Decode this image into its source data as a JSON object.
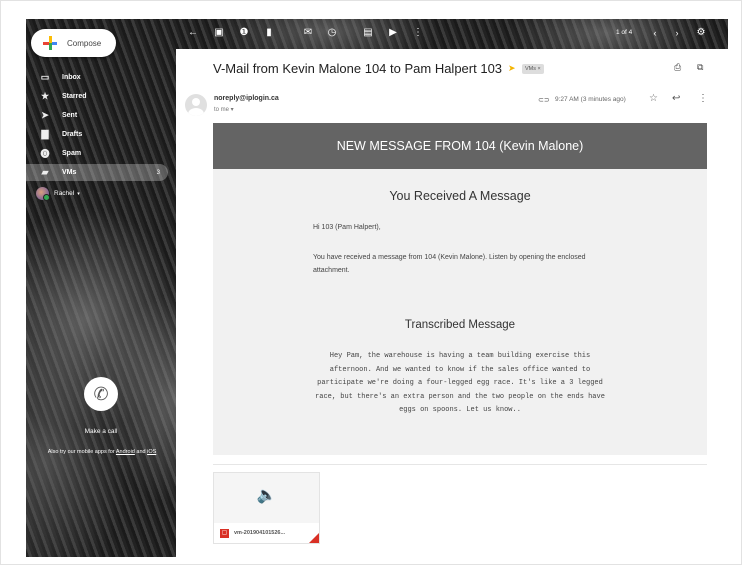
{
  "sidebar": {
    "compose_label": "Compose",
    "items": [
      {
        "label": "Inbox",
        "icon": "inbox-icon",
        "glyph": "▭"
      },
      {
        "label": "Starred",
        "icon": "star-icon",
        "glyph": "★"
      },
      {
        "label": "Sent",
        "icon": "send-icon",
        "glyph": "➤"
      },
      {
        "label": "Drafts",
        "icon": "draft-icon",
        "glyph": "▇"
      },
      {
        "label": "Spam",
        "icon": "spam-icon",
        "glyph": "⓿"
      },
      {
        "label": "VMs",
        "icon": "label-icon",
        "glyph": "▰",
        "count": "3"
      }
    ],
    "user_name": "Rachel",
    "make_call": "Make a call",
    "apps_text_prefix": "Also try our mobile apps for ",
    "apps_link_android": "Android",
    "apps_text_and": " and ",
    "apps_link_ios": "iOS"
  },
  "toolbar": {
    "pager": "1 of 4"
  },
  "email": {
    "subject": "V-Mail from Kevin Malone 104 to Pam Halpert 103",
    "label": "VMs ×",
    "sender": "noreply@iplogin.ca",
    "to": "to me ▾",
    "time": "9:27 AM (3 minutes ago)",
    "header": "NEW MESSAGE FROM 104 (Kevin Malone)",
    "received_title": "You Received A Message",
    "greeting": "Hi 103 (Pam Halpert),",
    "received_text": "You have received a message from 104 (Kevin Malone). Listen by opening the enclosed attachment.",
    "transcribed_title": "Transcribed Message",
    "transcribed_text": "Hey Pam, the warehouse is having a team building exercise this afternoon. And we wanted to know if the sales office wanted to participate we're doing a four-legged egg race. It's like a 3 legged race, but there's an extra person and the two people on the ends have eggs on spoons. Let us know..",
    "attachment_name": "vm-201904101526..."
  },
  "colors": {
    "header_bar": "#646464",
    "body_bg": "#f1f1f1",
    "pdf_red": "#d93025",
    "label_arrow": "#f4b400"
  }
}
